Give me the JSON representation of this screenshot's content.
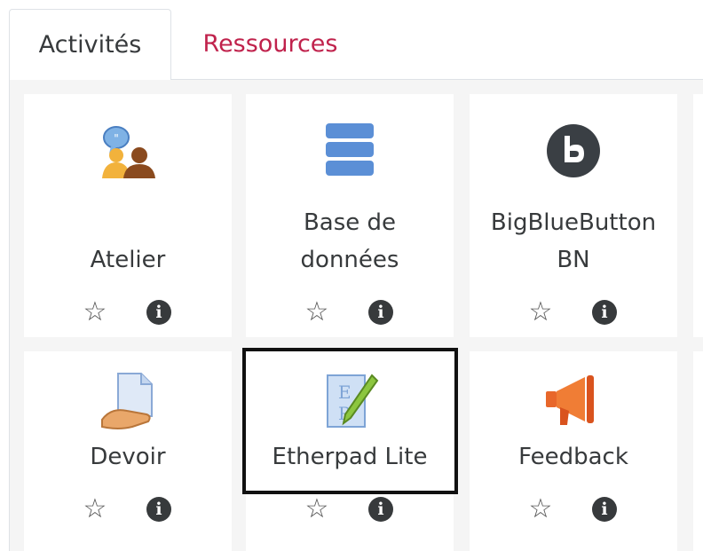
{
  "tabs": {
    "activities": "Activités",
    "resources": "Ressources"
  },
  "colors": {
    "resources_tab": "#c0224c",
    "text": "#373a3c",
    "panel_bg": "#f5f5f5"
  },
  "modules": [
    {
      "name": "Atelier",
      "icon": "workshop-icon"
    },
    {
      "name_line1": "Base de",
      "name_line2": "données",
      "icon": "database-icon"
    },
    {
      "name_line1": "BigBlueButton",
      "name_line2": "BN",
      "icon": "bigbluebutton-icon"
    },
    {
      "name": "Devoir",
      "icon": "assignment-icon"
    },
    {
      "name": "Etherpad Lite",
      "icon": "etherpad-icon"
    },
    {
      "name": "Feedback",
      "icon": "feedback-icon"
    }
  ],
  "symbols": {
    "star": "☆",
    "info": "i"
  }
}
